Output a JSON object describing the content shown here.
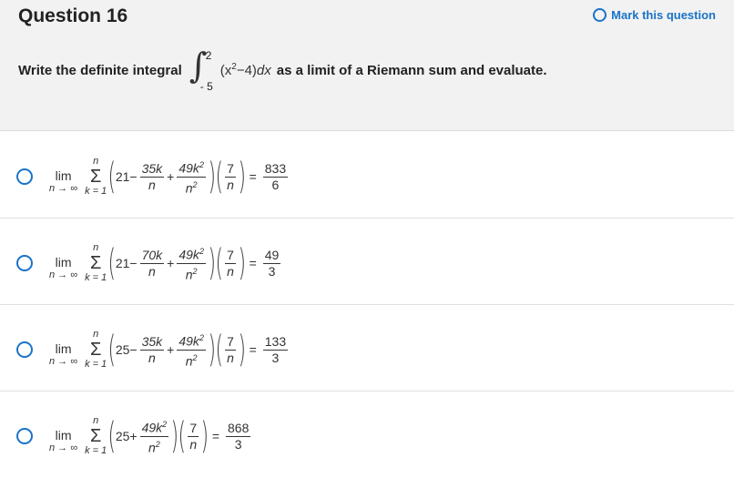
{
  "question": {
    "title": "Question 16",
    "mark_label": "Mark this question",
    "prompt_before": "Write the definite integral",
    "prompt_after": "as a limit of a Riemann sum and evaluate.",
    "integral": {
      "upper": "2",
      "lower": "- 5",
      "integrand_a": "(x",
      "integrand_exp": "2",
      "integrand_b": "−4)",
      "integrand_d": "dx"
    }
  },
  "common": {
    "lim": "lim",
    "lim_sub": "n → ∞",
    "sum_top": "n",
    "sum_symbol": "Σ",
    "sum_bot": "k = 1",
    "second_num": "49k",
    "second_den": "n",
    "exp": "2",
    "factor_num": "7",
    "factor_den": "n",
    "plus": "+",
    "minus": "−",
    "equals": "="
  },
  "options": [
    {
      "lead": "21−",
      "first_num": "35k",
      "first_den": "n",
      "result_num": "833",
      "result_den": "6"
    },
    {
      "lead": "21−",
      "first_num": "70k",
      "first_den": "n",
      "result_num": "49",
      "result_den": "3"
    },
    {
      "lead": "25−",
      "first_num": "35k",
      "first_den": "n",
      "result_num": "133",
      "result_den": "3"
    },
    {
      "lead": "25+",
      "result_num": "868",
      "result_den": "3"
    }
  ],
  "colors": {
    "accent": "#1a73c8",
    "header_bg": "#f2f2f2"
  }
}
